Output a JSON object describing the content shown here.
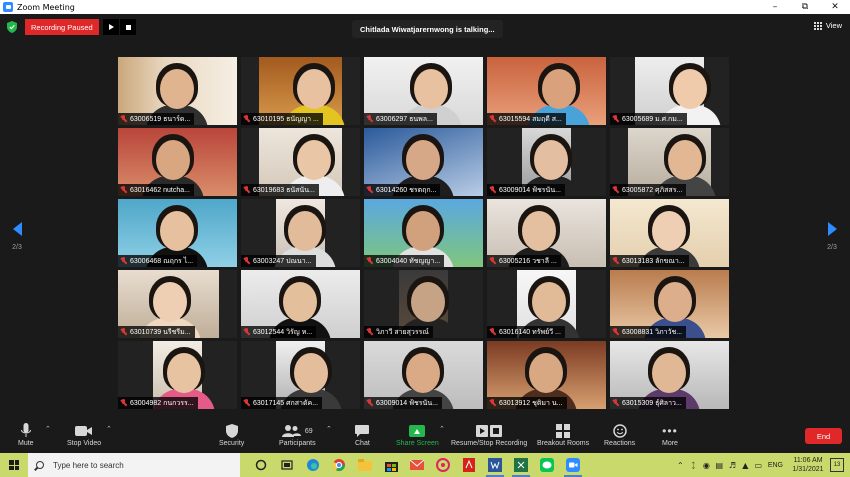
{
  "window": {
    "title": "Zoom Meeting",
    "controls": [
      "minimize",
      "maximize",
      "close"
    ]
  },
  "meeting": {
    "recording_status": "Recording Paused",
    "talking_indicator": "Chitlada Wiwatjarernwong is talking...",
    "view_label": "View",
    "page_indicator": "2/3",
    "participants": [
      {
        "label": "63006519 ธนาร์ด..."
      },
      {
        "label": "63010195 ธนัญญา ..."
      },
      {
        "label": "63006297 ธนพล..."
      },
      {
        "label": "63015594 สมฤดี ส..."
      },
      {
        "label": "63005689 ม.ศ.กม..."
      },
      {
        "label": "63016462 nutcha..."
      },
      {
        "label": "63019683 ธนัสนัน..."
      },
      {
        "label": "63014260 ชรตฤก..."
      },
      {
        "label": "63009014 ฟ้ชรนัน..."
      },
      {
        "label": "63005872 ศุภิสสร..."
      },
      {
        "label": "63006468 ณฤกร ไ..."
      },
      {
        "label": "63003247 ปณนา..."
      },
      {
        "label": "63004040 ทัชญญา..."
      },
      {
        "label": "63005216 วชาลี ..."
      },
      {
        "label": "63013183 ลักขณา..."
      },
      {
        "label": "63010739 นรีชรีม..."
      },
      {
        "label": "63012544 วิรัญ ห..."
      },
      {
        "label": "วิภาวี สายสุวรรณ์"
      },
      {
        "label": "63016140 ทรัพย์วี ..."
      },
      {
        "label": "63008831 วิภาวัช..."
      },
      {
        "label": "63004982 กนกวรร..."
      },
      {
        "label": "63017145 ศกสาดัค..."
      },
      {
        "label": "63009014 ฟ้ชรนัน..."
      },
      {
        "label": "63013912 ชุติมา น..."
      },
      {
        "label": "63015309 ธุ์ศิลาว..."
      }
    ]
  },
  "toolbar": {
    "mute": "Mute",
    "stop_video": "Stop Video",
    "security": "Security",
    "participants": "Participants",
    "participant_count": "69",
    "chat": "Chat",
    "share_screen": "Share Screen",
    "recording": "Resume/Stop Recording",
    "breakout_rooms": "Breakout Rooms",
    "reactions": "Reactions",
    "more": "More",
    "end": "End"
  },
  "taskbar": {
    "search_placeholder": "Type here to search",
    "language": "ENG",
    "time": "11:06 AM",
    "date": "1/31/2021",
    "notification_count": "13",
    "apps": [
      "cortana-icon",
      "task-view-icon",
      "edge-icon",
      "chrome-icon",
      "file-explorer-icon",
      "store-icon",
      "mail-icon",
      "photos-icon",
      "acrobat-icon",
      "word-icon",
      "excel-icon",
      "line-icon",
      "zoom-icon"
    ]
  },
  "colors": {
    "zoom_blue": "#2d8cff",
    "recording_red": "#e02828",
    "share_green": "#22b84c",
    "meeting_bg": "#1a1a1a",
    "taskbar_bg": "#c9d96c"
  }
}
